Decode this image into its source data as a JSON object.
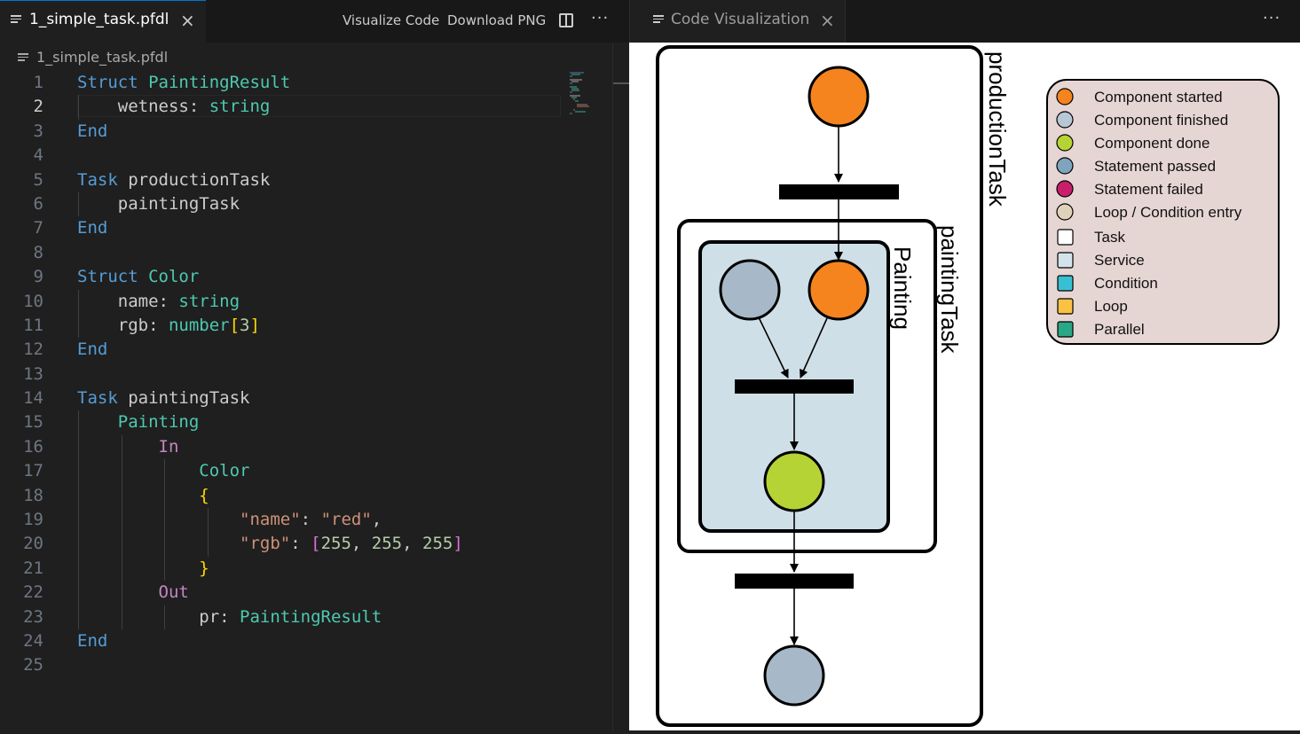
{
  "editor": {
    "tab": {
      "label": "1_simple_task.pfdl",
      "close": "×"
    },
    "toolbar": {
      "visualize_label": "Visualize Code",
      "download_label": "Download PNG",
      "more": "···"
    },
    "breadcrumb": "1_simple_task.pfdl",
    "current_line": 2,
    "lines": [
      {
        "n": "1",
        "tokens": [
          {
            "t": "Struct",
            "c": "kw"
          },
          {
            "t": " "
          },
          {
            "t": "PaintingResult",
            "c": "ty"
          }
        ]
      },
      {
        "n": "2",
        "tokens": [
          {
            "t": "    wetness: "
          },
          {
            "t": "string",
            "c": "ty"
          }
        ]
      },
      {
        "n": "3",
        "tokens": [
          {
            "t": "End",
            "c": "kw"
          }
        ]
      },
      {
        "n": "4",
        "tokens": []
      },
      {
        "n": "5",
        "tokens": [
          {
            "t": "Task",
            "c": "kw"
          },
          {
            "t": " productionTask"
          }
        ]
      },
      {
        "n": "6",
        "tokens": [
          {
            "t": "    paintingTask"
          }
        ]
      },
      {
        "n": "7",
        "tokens": [
          {
            "t": "End",
            "c": "kw"
          }
        ]
      },
      {
        "n": "8",
        "tokens": []
      },
      {
        "n": "9",
        "tokens": [
          {
            "t": "Struct",
            "c": "kw"
          },
          {
            "t": " "
          },
          {
            "t": "Color",
            "c": "ty"
          }
        ]
      },
      {
        "n": "10",
        "tokens": [
          {
            "t": "    name: "
          },
          {
            "t": "string",
            "c": "ty"
          }
        ]
      },
      {
        "n": "11",
        "tokens": [
          {
            "t": "    rgb: "
          },
          {
            "t": "number",
            "c": "ty"
          },
          {
            "t": "[",
            "c": "br"
          },
          {
            "t": "3",
            "c": "nu"
          },
          {
            "t": "]",
            "c": "br"
          }
        ]
      },
      {
        "n": "12",
        "tokens": [
          {
            "t": "End",
            "c": "kw"
          }
        ]
      },
      {
        "n": "13",
        "tokens": []
      },
      {
        "n": "14",
        "tokens": [
          {
            "t": "Task",
            "c": "kw"
          },
          {
            "t": " paintingTask"
          }
        ]
      },
      {
        "n": "15",
        "tokens": [
          {
            "t": "    "
          },
          {
            "t": "Painting",
            "c": "ty"
          }
        ]
      },
      {
        "n": "16",
        "tokens": [
          {
            "t": "        "
          },
          {
            "t": "In",
            "c": "pu"
          }
        ]
      },
      {
        "n": "17",
        "tokens": [
          {
            "t": "            "
          },
          {
            "t": "Color",
            "c": "ty"
          }
        ]
      },
      {
        "n": "18",
        "tokens": [
          {
            "t": "            "
          },
          {
            "t": "{",
            "c": "br"
          }
        ]
      },
      {
        "n": "19",
        "tokens": [
          {
            "t": "                "
          },
          {
            "t": "\"name\"",
            "c": "st"
          },
          {
            "t": ": "
          },
          {
            "t": "\"red\"",
            "c": "st"
          },
          {
            "t": ","
          }
        ]
      },
      {
        "n": "20",
        "tokens": [
          {
            "t": "                "
          },
          {
            "t": "\"rgb\"",
            "c": "st"
          },
          {
            "t": ": "
          },
          {
            "t": "[",
            "c": "br2"
          },
          {
            "t": "255",
            "c": "nu"
          },
          {
            "t": ", "
          },
          {
            "t": "255",
            "c": "nu"
          },
          {
            "t": ", "
          },
          {
            "t": "255",
            "c": "nu"
          },
          {
            "t": "]",
            "c": "br2"
          }
        ]
      },
      {
        "n": "21",
        "tokens": [
          {
            "t": "            "
          },
          {
            "t": "}",
            "c": "br"
          }
        ]
      },
      {
        "n": "22",
        "tokens": [
          {
            "t": "        "
          },
          {
            "t": "Out",
            "c": "pu"
          }
        ]
      },
      {
        "n": "23",
        "tokens": [
          {
            "t": "            pr: "
          },
          {
            "t": "PaintingResult",
            "c": "ty"
          }
        ]
      },
      {
        "n": "24",
        "tokens": [
          {
            "t": "End",
            "c": "kw"
          }
        ]
      },
      {
        "n": "25",
        "tokens": []
      }
    ]
  },
  "viz": {
    "tab": {
      "label": "Code Visualization",
      "close": "×"
    },
    "more": "···",
    "diagram": {
      "outer_cluster": "productionTask",
      "middle_cluster": "paintingTask",
      "inner_cluster": "Painting"
    },
    "colors": {
      "started": "#f5841f",
      "finished": "#a7b9c8",
      "done": "#b5d334",
      "passed": "#7fa5be",
      "failed": "#c91f6b",
      "entry": "#e0d2b9",
      "task": "#ffffff",
      "service": "#d2e3eb",
      "condition": "#39bfd2",
      "loop": "#f9c244",
      "parallel": "#2aa787",
      "legend_bg": "#e6d6d3",
      "service_fill": "#cfdfe7"
    },
    "legend": [
      {
        "label": "Component started",
        "shape": "circle",
        "color": "#f5841f"
      },
      {
        "label": "Component finished",
        "shape": "circle",
        "color": "#b7c7d5"
      },
      {
        "label": "Component done",
        "shape": "circle",
        "color": "#b5d334"
      },
      {
        "label": "Statement passed",
        "shape": "circle",
        "color": "#7fa5be"
      },
      {
        "label": "Statement failed",
        "shape": "circle",
        "color": "#c91f6b"
      },
      {
        "label": "Loop / Condition entry",
        "shape": "circle",
        "color": "#e0d2b9"
      },
      {
        "label": "Task",
        "shape": "square",
        "color": "#ffffff"
      },
      {
        "label": "Service",
        "shape": "square",
        "color": "#d2e3eb"
      },
      {
        "label": "Condition",
        "shape": "square",
        "color": "#39bfd2"
      },
      {
        "label": "Loop",
        "shape": "square",
        "color": "#f9c244"
      },
      {
        "label": "Parallel",
        "shape": "square",
        "color": "#2aa787"
      }
    ]
  }
}
